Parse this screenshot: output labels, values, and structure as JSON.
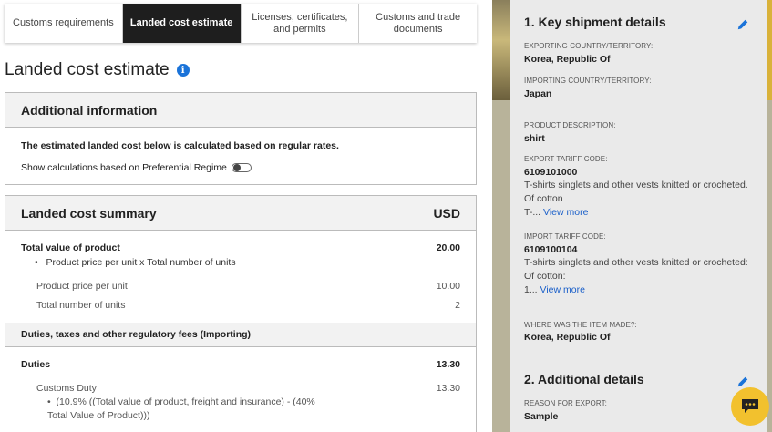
{
  "tabs": [
    {
      "label": "Customs requirements"
    },
    {
      "label": "Landed cost estimate"
    },
    {
      "label": "Licenses, certificates, and permits"
    },
    {
      "label": "Customs and trade documents"
    }
  ],
  "page_title": "Landed cost estimate",
  "additional_info": {
    "heading": "Additional information",
    "note": "The estimated landed cost below is calculated based on regular rates.",
    "preferential_label": "Show calculations based on Preferential Regime"
  },
  "summary": {
    "heading": "Landed cost summary",
    "currency": "USD",
    "total_value_label": "Total value of product",
    "total_value": "20.00",
    "total_value_bullet": "Product price per unit x Total number of units",
    "price_per_unit_label": "Product price per unit",
    "price_per_unit": "10.00",
    "units_label": "Total number of units",
    "units": "2",
    "duties_section": "Duties, taxes and other regulatory fees (Importing)",
    "duties_label": "Duties",
    "duties_value": "13.30",
    "customs_duty_label": "Customs Duty",
    "customs_duty_value": "13.30",
    "customs_duty_bullet_1": "(10.9% ((Total value of product, freight and insurance) - (40%",
    "customs_duty_bullet_2": "Total Value of Product)))"
  },
  "sidebar": {
    "section1_title": "1. Key shipment details",
    "exporting_label": "EXPORTING COUNTRY/TERRITORY:",
    "exporting_value": "Korea, Republic Of",
    "importing_label": "IMPORTING COUNTRY/TERRITORY:",
    "importing_value": "Japan",
    "product_label": "PRODUCT DESCRIPTION:",
    "product_value": "shirt",
    "export_code_label": "EXPORT TARIFF CODE:",
    "export_code_value": "6109101000",
    "export_desc_1": "T-shirts singlets and other vests knitted or crocheted.",
    "export_desc_2": "Of cotton",
    "export_desc_3": "T-...",
    "export_view_more": "View more",
    "import_code_label": "IMPORT TARIFF CODE:",
    "import_code_value": "6109100104",
    "import_desc_1": "T-shirts singlets and other vests knitted or crocheted:",
    "import_desc_2": "Of cotton:",
    "import_desc_3": "1...",
    "import_view_more": "View more",
    "made_label": "WHERE WAS THE ITEM MADE?:",
    "made_value": "Korea, Republic Of",
    "section2_title": "2. Additional details",
    "reason_label": "REASON FOR EXPORT:",
    "reason_value": "Sample"
  },
  "colors": {
    "accent_blue": "#1a73d9",
    "active_tab": "#1e1e1e",
    "chat_yellow": "#f2c12e"
  }
}
